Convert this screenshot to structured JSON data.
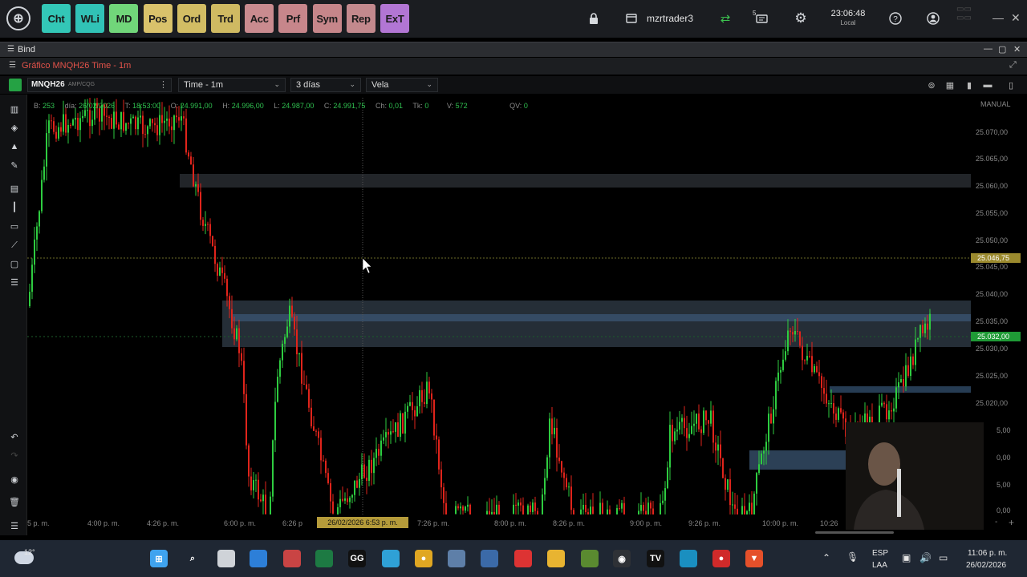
{
  "nav": [
    {
      "label": "Cht",
      "color": "#33c7b7"
    },
    {
      "label": "WLi",
      "color": "#31c2b6"
    },
    {
      "label": "MD",
      "color": "#71d67a"
    },
    {
      "label": "Pos",
      "color": "#d9c26b"
    },
    {
      "label": "Ord",
      "color": "#d2bd64"
    },
    {
      "label": "Trd",
      "color": "#cfba62"
    },
    {
      "label": "Acc",
      "color": "#c98b8f"
    },
    {
      "label": "Prf",
      "color": "#c7868b"
    },
    {
      "label": "Sym",
      "color": "#c6868a"
    },
    {
      "label": "Rep",
      "color": "#c3898d"
    },
    {
      "label": "ExT",
      "color": "#b276d4"
    }
  ],
  "header": {
    "username": "mzrtrader3",
    "time": "23:06:48",
    "time_label": "Local",
    "notification_count": "5"
  },
  "bind_bar": {
    "title": "Bind"
  },
  "chart_window": {
    "title": "Gráfico MNQH26 Time - 1m"
  },
  "toolbar": {
    "symbol": "MNQH26",
    "symbol_source": "AMP/CQG",
    "timeframe": "Time - 1m",
    "range": "3 días",
    "chart_style": "Vela"
  },
  "ohlc": {
    "b_label": "B:",
    "b": "253",
    "dia_label": "día:",
    "dia": "26/02/2026",
    "t_label": "T:",
    "t": "18:53:00",
    "o_label": "O:",
    "o": "24.991,00",
    "h_label": "H:",
    "h": "24.996,00",
    "l_label": "L:",
    "l": "24.987,00",
    "c_label": "C:",
    "c": "24.991,75",
    "ch_label": "Ch:",
    "ch": "0,01",
    "tk_label": "Tk:",
    "tk": "0",
    "v_label": "V:",
    "v": "572",
    "qv_label": "QV:",
    "qv": "0"
  },
  "price_axis": {
    "mode": "MANUAL",
    "ticks": [
      "25.070,00",
      "25.065,00",
      "25.060,00",
      "25.055,00",
      "25.050,00",
      "25.045,00",
      "25.040,00",
      "25.035,00",
      "25.030,00",
      "25.025,00",
      "25.020,00",
      "5,00",
      "0,00",
      "5,00",
      "0,00"
    ],
    "tags": [
      {
        "label": "25.046,75",
        "color": "#9b8a2e"
      },
      {
        "label": "25.032,00",
        "color": "#1f9a36"
      }
    ]
  },
  "time_axis": {
    "ticks": [
      "5 p. m.",
      "4:00 p. m.",
      "4:26 p. m.",
      "6:00 p. m.",
      "6:26 p",
      "7:26 p. m.",
      "8:00 p. m.",
      "8:26 p. m.",
      "9:00 p. m.",
      "9:26 p. m.",
      "10:00 p. m.",
      "10:26"
    ],
    "cursor_label": "26/02/2026 6:53 p. m."
  },
  "taskbar": {
    "weather": "12°",
    "lang_top": "ESP",
    "lang_bottom": "LAA",
    "clock_time": "11:06 p. m.",
    "clock_date": "26/02/2026"
  }
}
